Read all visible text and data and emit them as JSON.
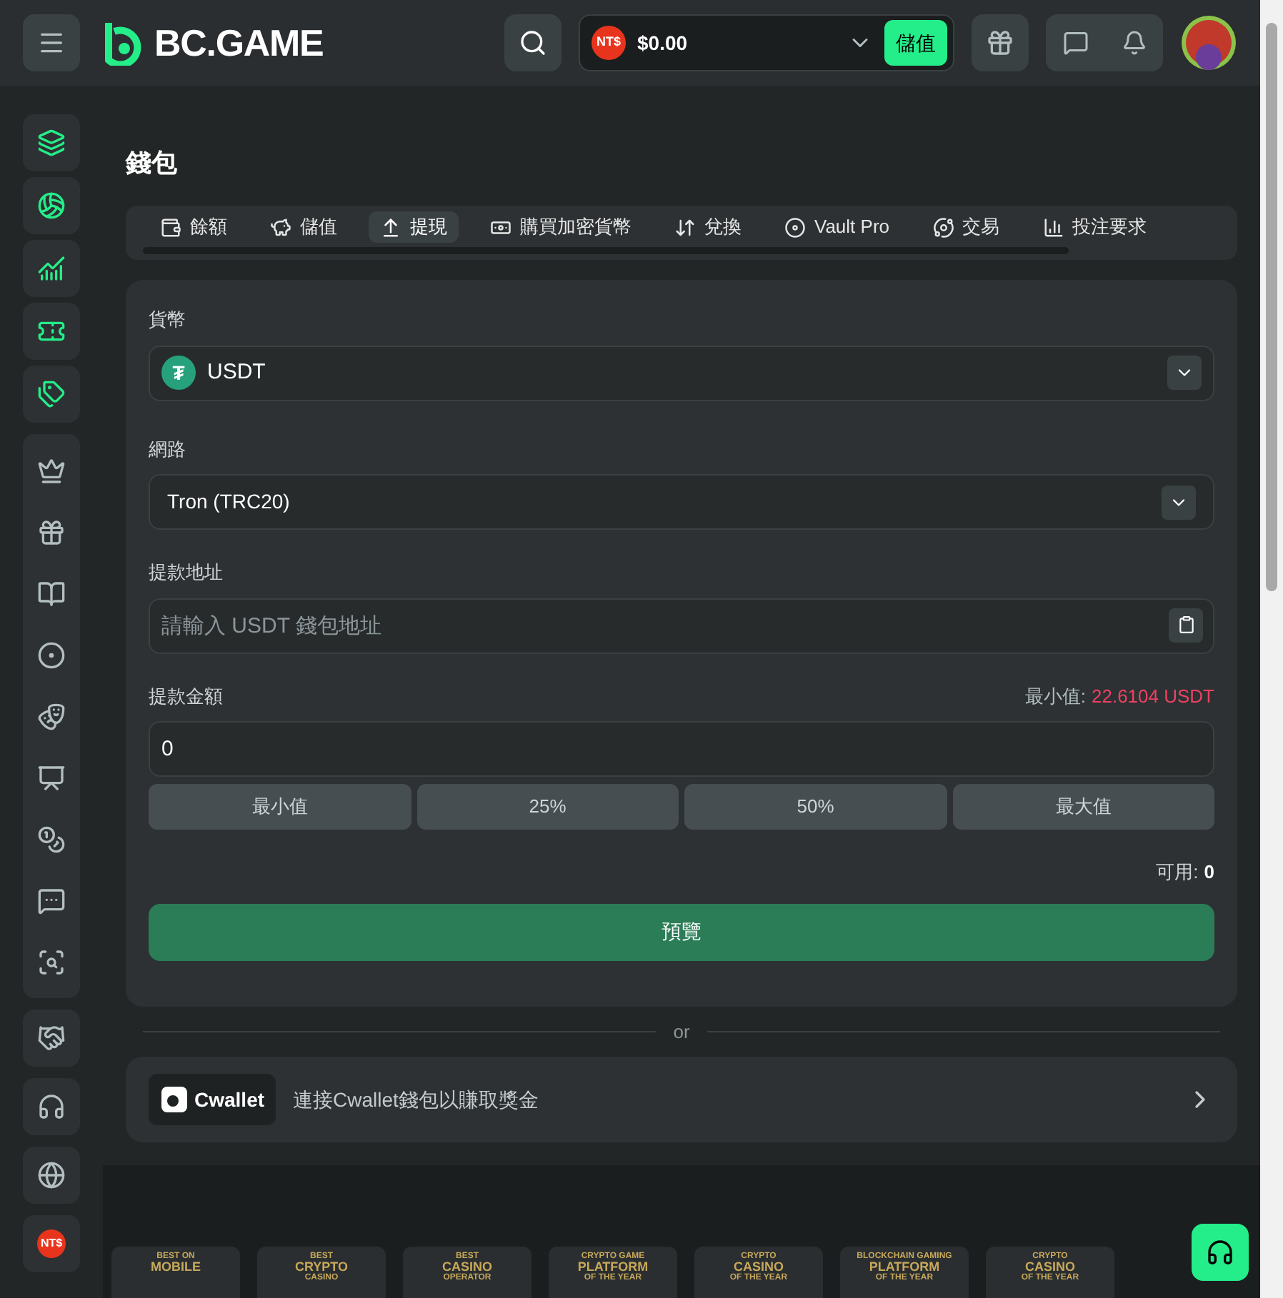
{
  "header": {
    "logo": "BC.GAME",
    "currency_badge": "NT$",
    "balance": "$0.00",
    "deposit_button": "儲值"
  },
  "sidebar": {
    "currency_badge": "NT$"
  },
  "page_title": "錢包",
  "tabs": [
    {
      "label": "餘額",
      "selected": false
    },
    {
      "label": "儲值",
      "selected": false
    },
    {
      "label": "提現",
      "selected": true
    },
    {
      "label": "購買加密貨幣",
      "selected": false
    },
    {
      "label": "兌換",
      "selected": false
    },
    {
      "label": "Vault Pro",
      "selected": false
    },
    {
      "label": "交易",
      "selected": false
    },
    {
      "label": "投注要求",
      "selected": false
    }
  ],
  "form": {
    "currency": {
      "label": "貨幣",
      "value": "USDT",
      "coin_symbol": "₮"
    },
    "network": {
      "label": "網路",
      "value": "Tron (TRC20)"
    },
    "address": {
      "label": "提款地址",
      "placeholder": "請輸入 USDT 錢包地址"
    },
    "amount": {
      "label": "提款金額",
      "min_label": "最小值:",
      "min_value": "22.6104 USDT",
      "value": "0",
      "quick_buttons": [
        "最小值",
        "25%",
        "50%",
        "最大值"
      ]
    },
    "available_label": "可用:",
    "available_value": "0",
    "preview_button": "預覽"
  },
  "divider_text": "or",
  "cwallet": {
    "logo": "Cwallet",
    "text": "連接Cwallet錢包以賺取獎金"
  },
  "awards": [
    {
      "lines": [
        "BEST ON",
        "MOBILE"
      ]
    },
    {
      "lines": [
        "BEST",
        "CRYPTO",
        "CASINO"
      ]
    },
    {
      "lines": [
        "BEST",
        "CASINO",
        "OPERATOR"
      ]
    },
    {
      "lines": [
        "CRYPTO GAME",
        "PLATFORM",
        "OF THE YEAR"
      ]
    },
    {
      "lines": [
        "CRYPTO",
        "CASINO",
        "OF THE YEAR"
      ]
    },
    {
      "lines": [
        "BLOCKCHAIN GAMING",
        "PLATFORM",
        "OF THE YEAR"
      ]
    },
    {
      "lines": [
        "CRYPTO",
        "CASINO",
        "OF THE YEAR"
      ]
    }
  ]
}
